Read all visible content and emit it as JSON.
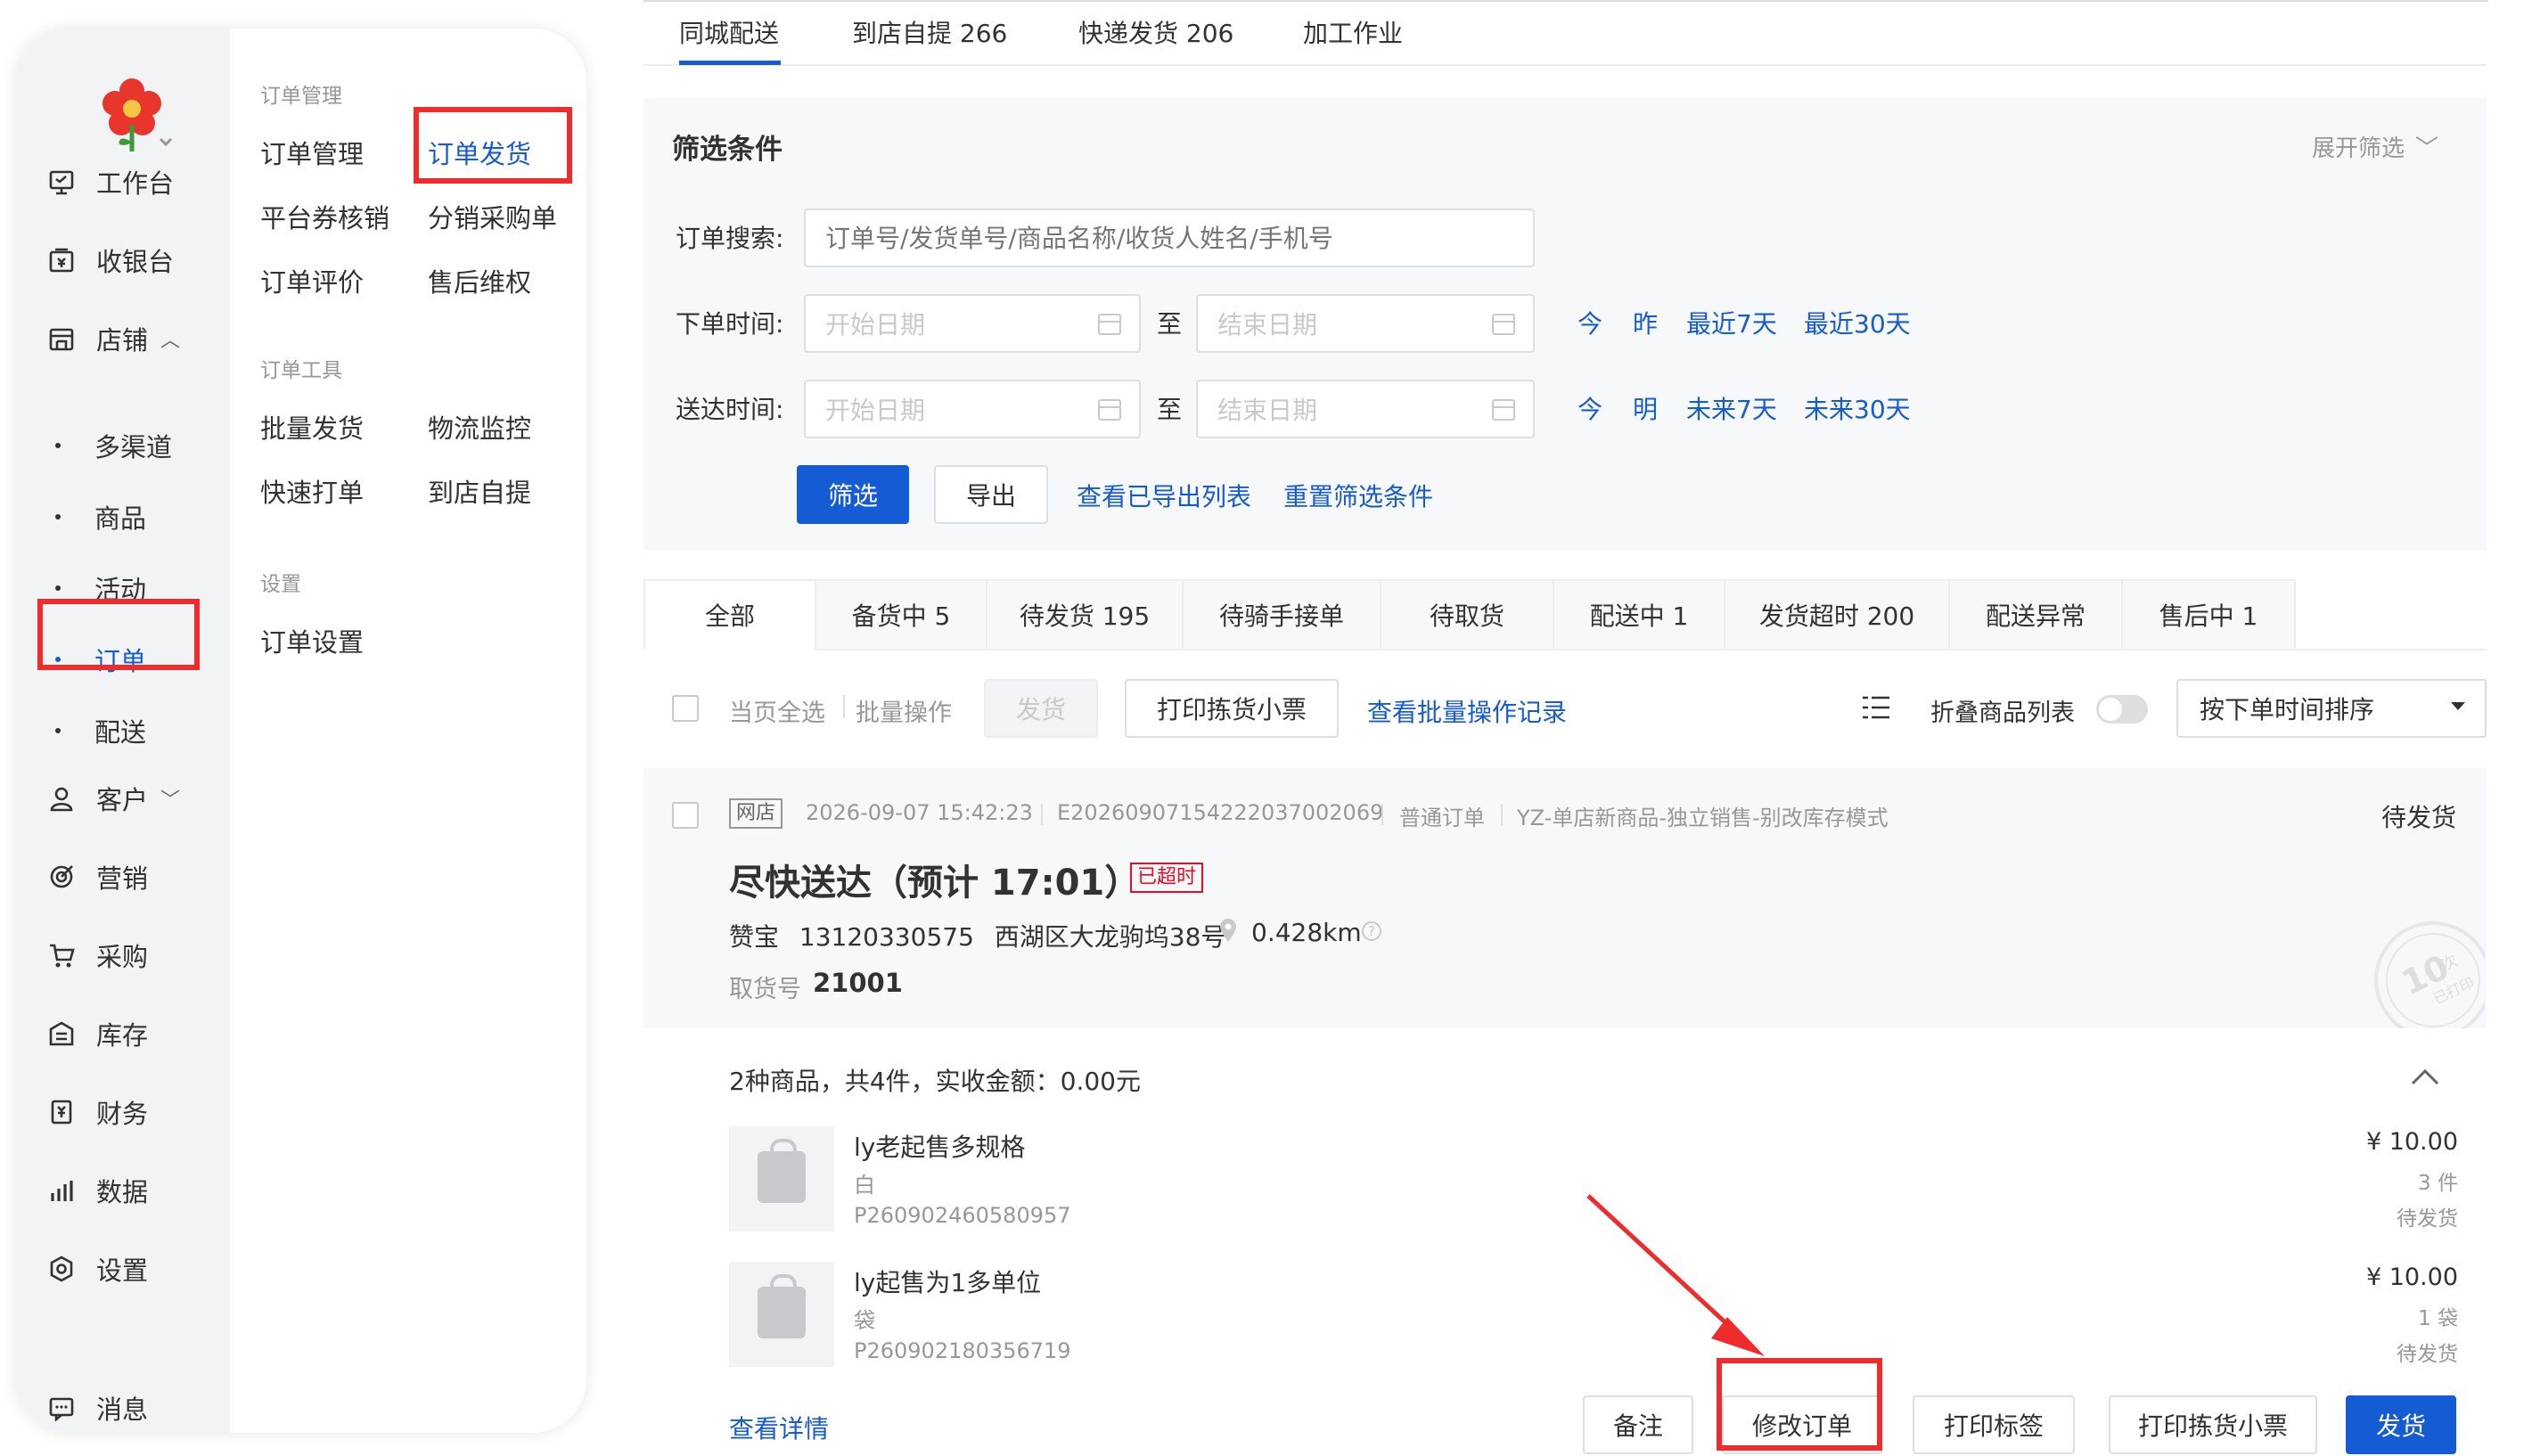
{
  "sidebar": {
    "primary": [
      {
        "icon": "workbench-icon",
        "label": "工作台"
      },
      {
        "icon": "cashier-icon",
        "label": "收银台"
      },
      {
        "icon": "shop-icon",
        "label": "店铺"
      },
      {
        "icon": "customer-icon",
        "label": "客户"
      },
      {
        "icon": "marketing-icon",
        "label": "营销"
      },
      {
        "icon": "cart-icon",
        "label": "采购"
      },
      {
        "icon": "inventory-icon",
        "label": "库存"
      },
      {
        "icon": "finance-icon",
        "label": "财务"
      },
      {
        "icon": "data-icon",
        "label": "数据"
      },
      {
        "icon": "settings-icon",
        "label": "设置"
      },
      {
        "icon": "message-icon",
        "label": "消息"
      }
    ],
    "shop_children": [
      "多渠道",
      "商品",
      "活动",
      "订单",
      "配送"
    ],
    "active_child": "订单"
  },
  "submenu": {
    "group1_title": "订单管理",
    "group1": [
      "订单管理",
      "订单发货",
      "平台券核销",
      "分销采购单",
      "订单评价",
      "售后维权"
    ],
    "group2_title": "订单工具",
    "group2": [
      "批量发货",
      "物流监控",
      "快速打单",
      "到店自提"
    ],
    "group3_title": "设置",
    "group3": [
      "订单设置"
    ],
    "active": "订单发货"
  },
  "top_tabs": [
    "同城配送",
    "到店自提 266",
    "快递发货 206",
    "加工作业"
  ],
  "filter": {
    "title": "筛选条件",
    "expand": "展开筛选",
    "search_label": "订单搜索:",
    "search_placeholder": "订单号/发货单号/商品名称/收货人姓名/手机号",
    "order_time_label": "下单时间:",
    "delivery_time_label": "送达时间:",
    "start_placeholder": "开始日期",
    "end_placeholder": "结束日期",
    "to": "至",
    "order_quick": [
      "今",
      "昨",
      "最近7天",
      "最近30天"
    ],
    "delivery_quick": [
      "今",
      "明",
      "未来7天",
      "未来30天"
    ],
    "filter_btn": "筛选",
    "export_btn": "导出",
    "view_exported": "查看已导出列表",
    "reset": "重置筛选条件"
  },
  "status_tabs": [
    "全部",
    "备货中 5",
    "待发货 195",
    "待骑手接单",
    "待取货",
    "配送中 1",
    "发货超时 200",
    "配送异常",
    "售后中 1"
  ],
  "toolbar": {
    "select_all": "当页全选",
    "batch": "批量操作",
    "ship": "发货",
    "print_pick": "打印拣货小票",
    "batch_log": "查看批量操作记录",
    "fold": "折叠商品列表",
    "sort": "按下单时间排序"
  },
  "order": {
    "channel": "网店",
    "time": "2026-09-07 15:42:23",
    "no": "E20260907154222037002069",
    "type": "普通订单",
    "shop": "YZ-单店新商品-独立销售-别改库存模式",
    "status": "待发货",
    "headline": "尽快送达（预计 17:01）",
    "late": "已超时",
    "receiver": "赞宝",
    "phone": "13120330575",
    "address": "西湖区大龙驹坞38号",
    "distance": "0.428km",
    "pickup_label": "取货号",
    "pickup_no": "21001",
    "stamp": "10次 已打印",
    "summary": "2种商品，共4件，实收金额：0.00元",
    "items": [
      {
        "name": "ly老起售多规格",
        "spec": "白",
        "code": "P260902460580957",
        "price": "¥ 10.00",
        "qty": "3 件",
        "state": "待发货"
      },
      {
        "name": "ly起售为1多单位",
        "spec": "袋",
        "code": "P260902180356719",
        "price": "¥ 10.00",
        "qty": "1 袋",
        "state": "待发货"
      }
    ],
    "detail_link": "查看详情",
    "actions": [
      "备注",
      "修改订单",
      "打印标签",
      "打印拣货小票",
      "发货"
    ]
  },
  "colors": {
    "accent": "#155bd4",
    "highlight": "#ee2c2c",
    "danger": "#ee0a24"
  }
}
